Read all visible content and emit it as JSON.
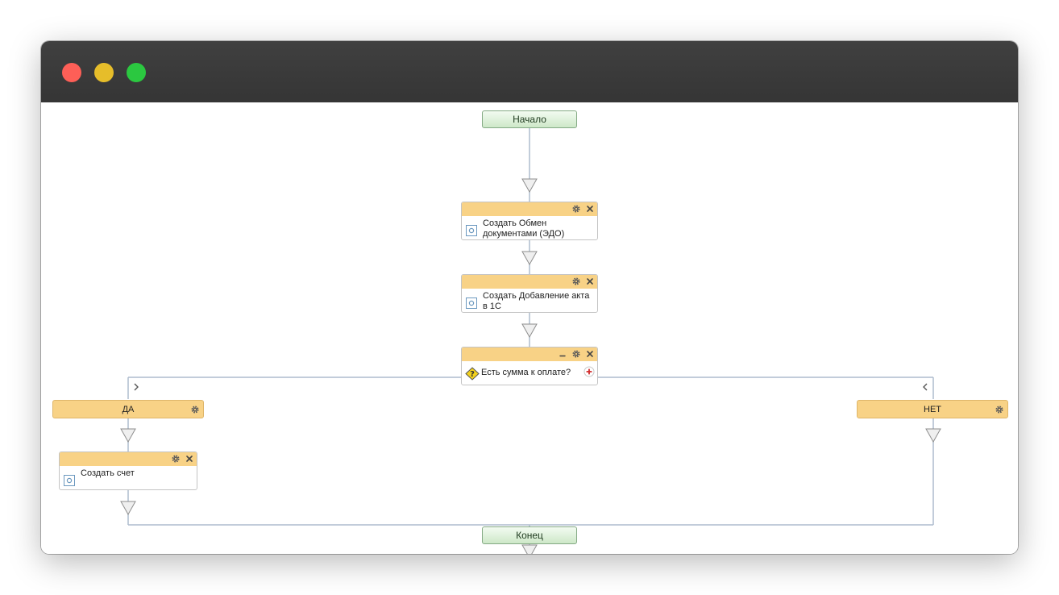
{
  "window": {
    "controls": [
      "close",
      "minimize",
      "zoom"
    ]
  },
  "flow": {
    "start_label": "Начало",
    "end_label": "Конец",
    "activities": [
      {
        "label": "Создать Обмен документами (ЭДО)"
      },
      {
        "label": "Создать Добавление акта в 1С"
      }
    ],
    "condition": {
      "label": "Есть сумма к оплате?"
    },
    "branches": {
      "yes": {
        "label": "ДА",
        "activity_label": "Создать счет"
      },
      "no": {
        "label": "НЕТ"
      }
    }
  },
  "icons": {
    "settings": "gear-icon",
    "delete": "close-icon",
    "collapse": "minimize-icon",
    "activity": "activity-icon",
    "condition": "condition-icon",
    "add_branch": "plus-icon"
  },
  "colors": {
    "block_header": "#f8d286",
    "terminal_fill": "#cde8c8",
    "connector": "#aebccd",
    "close_light": "#fe5f57",
    "minimize_light": "#e6bd2a",
    "zoom_light": "#2bc840"
  }
}
